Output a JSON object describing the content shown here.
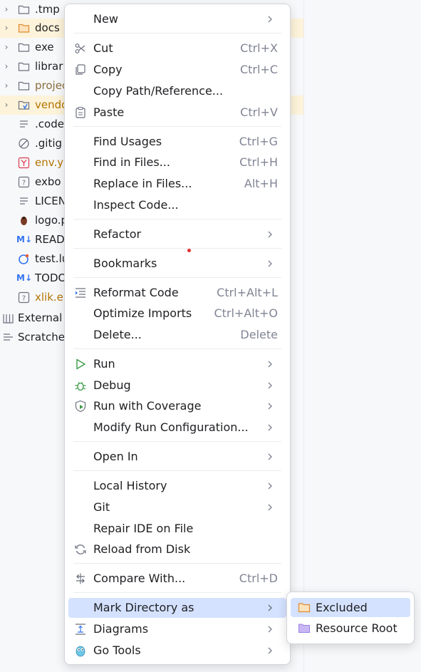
{
  "tree": {
    "rows": [
      {
        "label": ".tmp"
      },
      {
        "label": "docs"
      },
      {
        "label": "exe"
      },
      {
        "label": "librar"
      },
      {
        "label": "projec"
      },
      {
        "label": "vendo"
      },
      {
        "label": ".code"
      },
      {
        "label": ".gitig"
      },
      {
        "label": "env.y"
      },
      {
        "label": "exbo"
      },
      {
        "label": "LICEN"
      },
      {
        "label": "logo.p"
      },
      {
        "label": "READ"
      },
      {
        "label": "test.lu"
      },
      {
        "label": "TODO"
      },
      {
        "label": "xlik.e"
      },
      {
        "label": "External"
      },
      {
        "label": "Scratche"
      }
    ],
    "md_badge": "M↓"
  },
  "menu": {
    "new": {
      "label": "New"
    },
    "cut": {
      "label": "Cut",
      "shortcut": "Ctrl+X"
    },
    "copy": {
      "label": "Copy",
      "shortcut": "Ctrl+C"
    },
    "copy_path": {
      "label": "Copy Path/Reference..."
    },
    "paste": {
      "label": "Paste",
      "shortcut": "Ctrl+V"
    },
    "find_usages": {
      "label": "Find Usages",
      "shortcut": "Ctrl+G"
    },
    "find_in_files": {
      "label": "Find in Files...",
      "shortcut": "Ctrl+H"
    },
    "replace_in_files": {
      "label": "Replace in Files...",
      "shortcut": "Alt+H"
    },
    "inspect_code": {
      "label": "Inspect Code..."
    },
    "refactor": {
      "label": "Refactor"
    },
    "bookmarks": {
      "label": "Bookmarks"
    },
    "reformat_code": {
      "label": "Reformat Code",
      "shortcut": "Ctrl+Alt+L"
    },
    "optimize_imports": {
      "label": "Optimize Imports",
      "shortcut": "Ctrl+Alt+O"
    },
    "delete": {
      "label": "Delete...",
      "shortcut": "Delete"
    },
    "run": {
      "label": "Run"
    },
    "debug": {
      "label": "Debug"
    },
    "run_coverage": {
      "label": "Run with Coverage"
    },
    "modify_run_config": {
      "label": "Modify Run Configuration..."
    },
    "open_in": {
      "label": "Open In"
    },
    "local_history": {
      "label": "Local History"
    },
    "git": {
      "label": "Git"
    },
    "repair_ide": {
      "label": "Repair IDE on File"
    },
    "reload_disk": {
      "label": "Reload from Disk"
    },
    "compare_with": {
      "label": "Compare With...",
      "shortcut": "Ctrl+D"
    },
    "mark_directory": {
      "label": "Mark Directory as"
    },
    "diagrams": {
      "label": "Diagrams"
    },
    "go_tools": {
      "label": "Go Tools"
    }
  },
  "submenu": {
    "excluded": {
      "label": "Excluded"
    },
    "resource_root": {
      "label": "Resource Root"
    }
  },
  "colors": {
    "hover": "#d4e2ff",
    "selected_row": "#fdf3da",
    "excluded_folder": "#f0a35a",
    "resource_folder": "#b9a5f0"
  }
}
